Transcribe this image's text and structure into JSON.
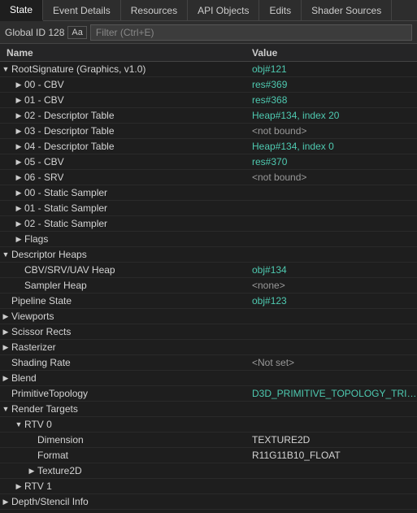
{
  "tabs": [
    {
      "id": "state",
      "label": "State",
      "active": true
    },
    {
      "id": "event-details",
      "label": "Event Details",
      "active": false
    },
    {
      "id": "resources",
      "label": "Resources",
      "active": false
    },
    {
      "id": "api-objects",
      "label": "API Objects",
      "active": false
    },
    {
      "id": "edits",
      "label": "Edits",
      "active": false
    },
    {
      "id": "shader-sources",
      "label": "Shader Sources",
      "active": false
    }
  ],
  "toolbar": {
    "global_id_label": "Global ID 128",
    "aa_label": "Aa",
    "filter_placeholder": "Filter (Ctrl+E)"
  },
  "columns": {
    "name": "Name",
    "value": "Value"
  },
  "rows": [
    {
      "id": 1,
      "indent": 0,
      "expander": "▼",
      "name": "RootSignature (Graphics, v1.0)",
      "value": "obj#121",
      "val_class": "val-link"
    },
    {
      "id": 2,
      "indent": 1,
      "expander": "▶",
      "name": "00 - CBV",
      "value": "res#369",
      "val_class": "val-link"
    },
    {
      "id": 3,
      "indent": 1,
      "expander": "▶",
      "name": "01 - CBV",
      "value": "res#368",
      "val_class": "val-link"
    },
    {
      "id": 4,
      "indent": 1,
      "expander": "▶",
      "name": "02 - Descriptor Table",
      "value": "Heap#134, index 20",
      "val_class": "val-link"
    },
    {
      "id": 5,
      "indent": 1,
      "expander": "▶",
      "name": "03 - Descriptor Table",
      "value": "<not bound>",
      "val_class": "val-gray"
    },
    {
      "id": 6,
      "indent": 1,
      "expander": "▶",
      "name": "04 - Descriptor Table",
      "value": "Heap#134, index 0",
      "val_class": "val-link"
    },
    {
      "id": 7,
      "indent": 1,
      "expander": "▶",
      "name": "05 - CBV",
      "value": "res#370",
      "val_class": "val-link"
    },
    {
      "id": 8,
      "indent": 1,
      "expander": "▶",
      "name": "06 - SRV",
      "value": "<not bound>",
      "val_class": "val-gray"
    },
    {
      "id": 9,
      "indent": 1,
      "expander": "▶",
      "name": "00 - Static Sampler",
      "value": "",
      "val_class": "val-white"
    },
    {
      "id": 10,
      "indent": 1,
      "expander": "▶",
      "name": "01 - Static Sampler",
      "value": "",
      "val_class": "val-white"
    },
    {
      "id": 11,
      "indent": 1,
      "expander": "▶",
      "name": "02 - Static Sampler",
      "value": "",
      "val_class": "val-white"
    },
    {
      "id": 12,
      "indent": 1,
      "expander": "▶",
      "name": "Flags",
      "value": "",
      "val_class": "val-white"
    },
    {
      "id": 13,
      "indent": 0,
      "expander": "▼",
      "name": "Descriptor Heaps",
      "value": "",
      "val_class": "val-white"
    },
    {
      "id": 14,
      "indent": 1,
      "expander": "",
      "name": "CBV/SRV/UAV Heap",
      "value": "obj#134",
      "val_class": "val-link"
    },
    {
      "id": 15,
      "indent": 1,
      "expander": "",
      "name": "Sampler Heap",
      "value": "<none>",
      "val_class": "val-gray"
    },
    {
      "id": 16,
      "indent": 0,
      "expander": "",
      "name": "Pipeline State",
      "value": "obj#123",
      "val_class": "val-link"
    },
    {
      "id": 17,
      "indent": 0,
      "expander": "▶",
      "name": "Viewports",
      "value": "",
      "val_class": "val-white"
    },
    {
      "id": 18,
      "indent": 0,
      "expander": "▶",
      "name": "Scissor Rects",
      "value": "",
      "val_class": "val-white"
    },
    {
      "id": 19,
      "indent": 0,
      "expander": "▶",
      "name": "Rasterizer",
      "value": "",
      "val_class": "val-white"
    },
    {
      "id": 20,
      "indent": 0,
      "expander": "",
      "name": "Shading Rate",
      "value": "<Not set>",
      "val_class": "val-gray"
    },
    {
      "id": 21,
      "indent": 0,
      "expander": "▶",
      "name": "Blend",
      "value": "",
      "val_class": "val-white"
    },
    {
      "id": 22,
      "indent": 0,
      "expander": "",
      "name": "PrimitiveTopology",
      "value": "D3D_PRIMITIVE_TOPOLOGY_TRI…",
      "val_class": "val-link"
    },
    {
      "id": 23,
      "indent": 0,
      "expander": "▼",
      "name": "Render Targets",
      "value": "",
      "val_class": "val-white"
    },
    {
      "id": 24,
      "indent": 1,
      "expander": "▼",
      "name": "RTV 0",
      "value": "",
      "val_class": "val-white"
    },
    {
      "id": 25,
      "indent": 2,
      "expander": "",
      "name": "Dimension",
      "value": "TEXTURE2D",
      "val_class": "val-white"
    },
    {
      "id": 26,
      "indent": 2,
      "expander": "",
      "name": "Format",
      "value": "R11G11B10_FLOAT",
      "val_class": "val-white"
    },
    {
      "id": 27,
      "indent": 2,
      "expander": "▶",
      "name": "Texture2D",
      "value": "",
      "val_class": "val-white"
    },
    {
      "id": 28,
      "indent": 1,
      "expander": "▶",
      "name": "RTV 1",
      "value": "",
      "val_class": "val-white"
    },
    {
      "id": 29,
      "indent": 0,
      "expander": "▶",
      "name": "Depth/Stencil Info",
      "value": "",
      "val_class": "val-white"
    }
  ]
}
